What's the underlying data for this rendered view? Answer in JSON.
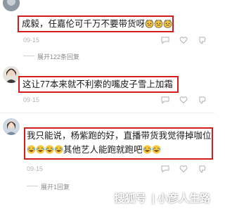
{
  "comments": [
    {
      "text": "成毅，任嘉伦可千万不要带货呀",
      "meta": "09·15",
      "expand": "展开122条回复",
      "emoji": "crying-cat-emoji"
    },
    {
      "text": "这让77本来就不利索的嘴皮子雪上加霜",
      "meta": "09·15"
    },
    {
      "text_line1": "我只能说，杨紫跑的好，直播带货我觉得掉咖位",
      "text_line2": "其他艺人能跑就跑吧",
      "meta": "09·15",
      "expand": "展开1回复",
      "emoji": "laughing-crying-emoji"
    }
  ],
  "watermark": {
    "logo": "搜狐号",
    "sep": "|",
    "author": "小彦人生路"
  },
  "colors": {
    "highlight": "#d41c1c",
    "meta": "#b4b4b4"
  }
}
